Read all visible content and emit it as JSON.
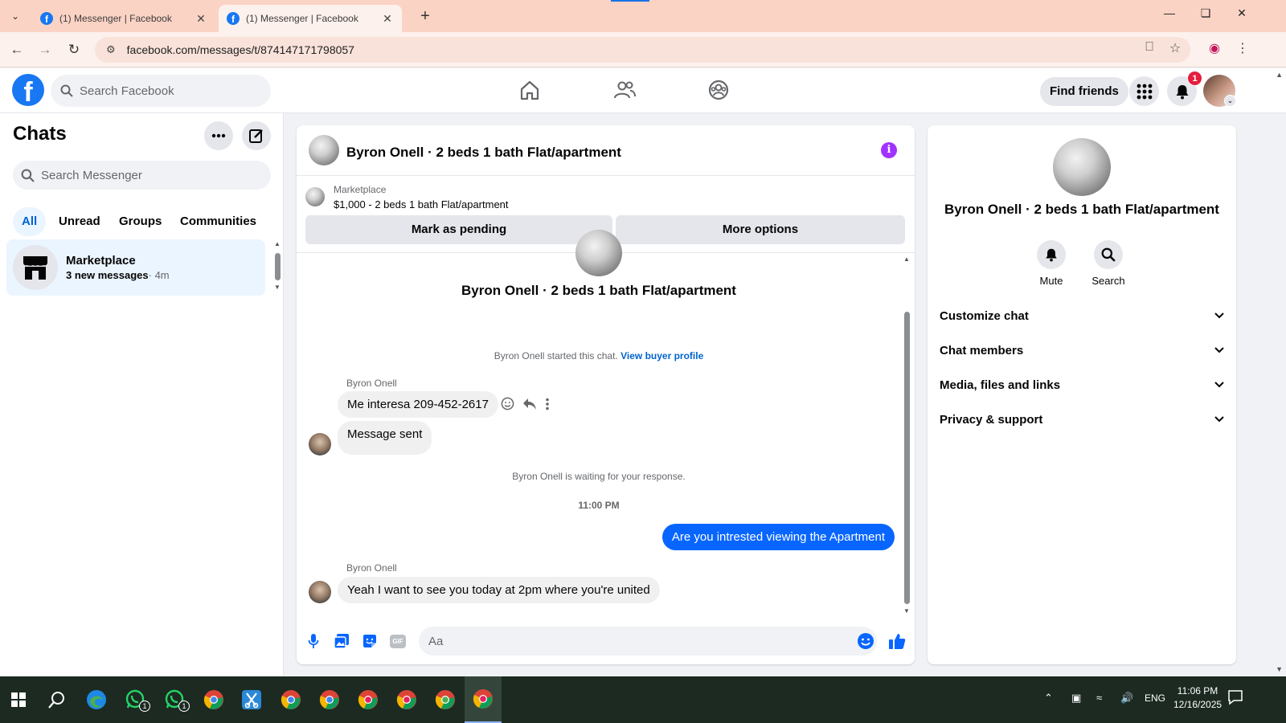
{
  "browser": {
    "tabs": [
      {
        "title": "(1) Messenger | Facebook",
        "active": false
      },
      {
        "title": "(1) Messenger | Facebook",
        "active": true
      }
    ],
    "url": "facebook.com/messages/t/874147171798057"
  },
  "fb_header": {
    "search_placeholder": "Search Facebook",
    "find_friends": "Find friends",
    "notifications_count": "1"
  },
  "sidebar": {
    "title": "Chats",
    "search_placeholder": "Search Messenger",
    "filters": [
      "All",
      "Unread",
      "Groups",
      "Communities"
    ],
    "chats": [
      {
        "name": "Marketplace",
        "preview": "3 new messages",
        "time": "· 4m"
      }
    ]
  },
  "conversation": {
    "title": "Byron Onell · 2 beds 1 bath Flat/apartment",
    "marketplace": {
      "label": "Marketplace",
      "listing": "$1,000 - 2 beds 1 bath Flat/apartment",
      "btn_pending": "Mark as pending",
      "btn_more": "More options"
    },
    "thread_title": "Byron Onell · 2 beds 1 bath Flat/apartment",
    "started_text": "Byron Onell started this chat.",
    "view_buyer": "View buyer profile",
    "messages": [
      {
        "sender": "Byron Onell",
        "text": "Me interesa 209-452-2617"
      },
      {
        "text": "Message sent"
      }
    ],
    "waiting_text": "Byron Onell is waiting for your response.",
    "timestamp": "11:00 PM",
    "outgoing": "Are you intrested viewing the Apartment",
    "reply_sender": "Byron Onell",
    "reply_text": "Yeah I want to see you today at 2pm where you're united",
    "composer_placeholder": "Aa",
    "gif_label": "GIF"
  },
  "right_panel": {
    "title": "Byron Onell · 2 beds 1 bath Flat/apartment",
    "actions": [
      "Mute",
      "Search"
    ],
    "sections": [
      "Customize chat",
      "Chat members",
      "Media, files and links",
      "Privacy & support"
    ]
  },
  "taskbar": {
    "language": "ENG",
    "time": "11:06 PM",
    "date": "12/16/2025",
    "whatsapp_badges": [
      "1",
      "1"
    ]
  },
  "colors": {
    "fb_blue": "#1877f2",
    "messenger_blue": "#0866ff",
    "info_purple": "#a033ff",
    "tab_bar": "#fbd3c4"
  }
}
